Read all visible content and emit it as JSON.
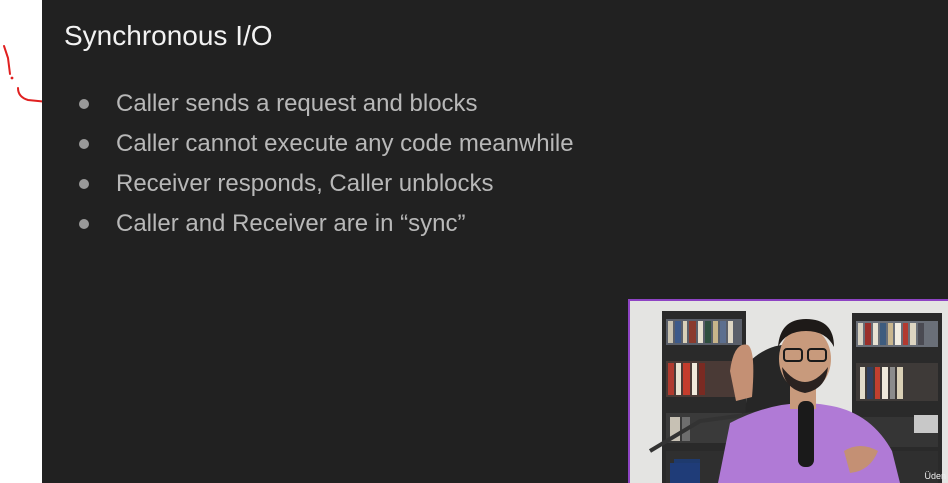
{
  "slide": {
    "title": "Synchronous I/O",
    "bullets": [
      "Caller sends a request and blocks",
      "Caller cannot execute any code meanwhile",
      "Receiver responds, Caller unblocks",
      "Caller and Receiver are in “sync”"
    ]
  },
  "webcam": {
    "watermark": "Üden",
    "border_color": "#8e44c4",
    "shirt_color": "#b07ad6"
  },
  "annotation": {
    "ink_color": "#e02020"
  }
}
